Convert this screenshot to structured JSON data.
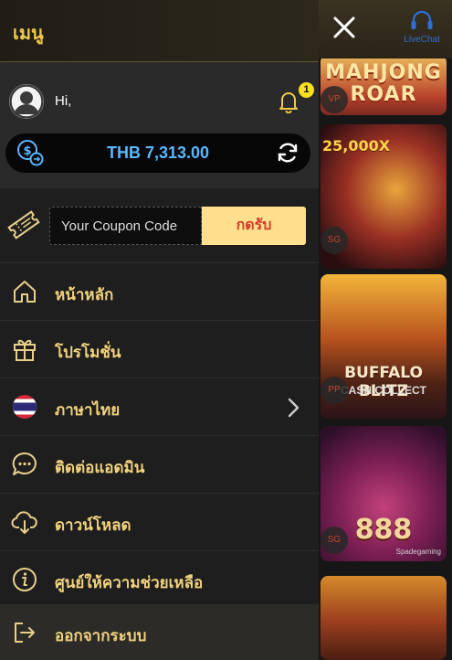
{
  "header": {
    "title": "เมนู"
  },
  "user": {
    "greeting": "Hi,",
    "notification_count": "1"
  },
  "balance": {
    "text": "THB 7,313.00"
  },
  "coupon": {
    "placeholder": "Your Coupon Code",
    "button_label": "กดรับ"
  },
  "menu": {
    "items": [
      {
        "label": "หน้าหลัก",
        "icon": "home-icon"
      },
      {
        "label": "โปรโมชั่น",
        "icon": "gift-icon"
      },
      {
        "label": "ภาษาไทย",
        "icon": "thai-flag-icon"
      },
      {
        "label": "ติดต่อแอดมิน",
        "icon": "chat-bubble-icon"
      },
      {
        "label": "ดาวน์โหลด",
        "icon": "cloud-download-icon"
      },
      {
        "label": "ศูนย์ให้ความช่วยเหลือ",
        "icon": "info-icon"
      },
      {
        "label": "ออกจากระบบ",
        "icon": "logout-icon"
      }
    ]
  },
  "livechat": {
    "label": "LiveChat"
  },
  "games": [
    {
      "title": "MAHJONG ROAR"
    },
    {
      "title": "25,000X"
    },
    {
      "title": "BUFFALO BLITZ",
      "subtitle": "CASH COLLECT"
    },
    {
      "title": "888",
      "maker": "Spadegaming"
    },
    {
      "title": ""
    }
  ],
  "colors": {
    "accent": "#f1c84a",
    "menu_text": "#f1d27c",
    "balance_text": "#5ab8ff",
    "coupon_button": "#ffe08e",
    "coupon_button_text": "#d33a2a",
    "notification_badge": "#f8df1f"
  }
}
